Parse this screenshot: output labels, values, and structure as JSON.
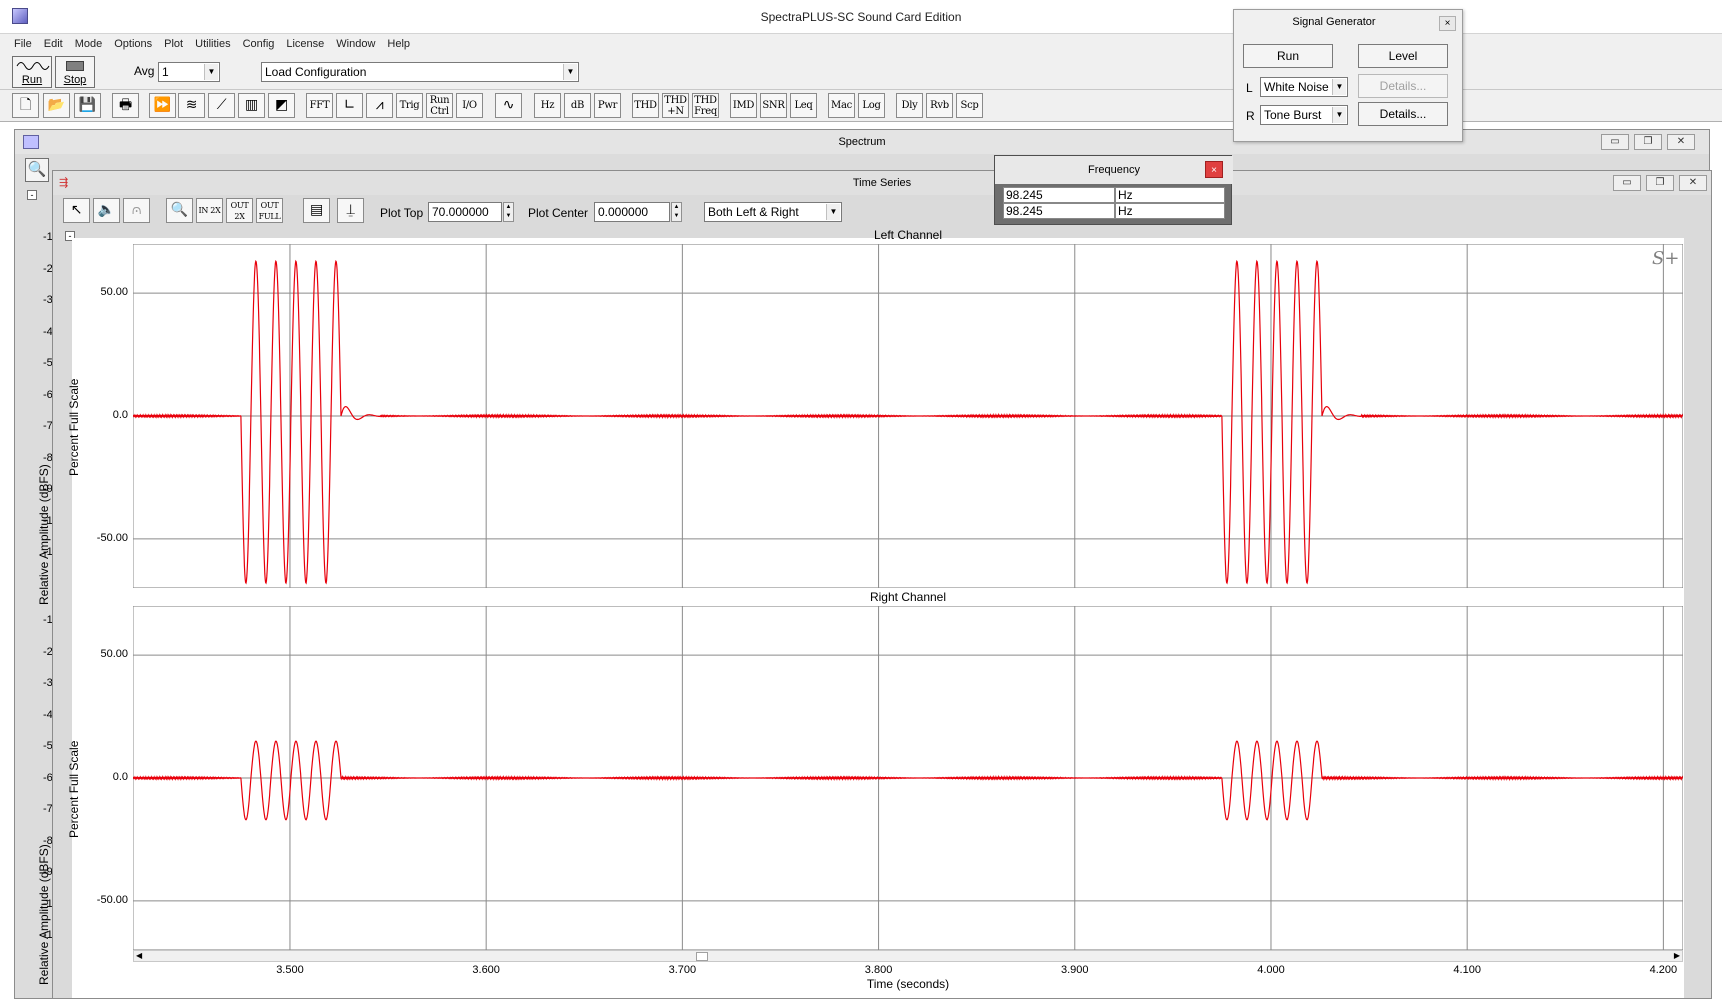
{
  "app": {
    "title": "SpectraPLUS-SC Sound Card Edition",
    "menu": [
      "File",
      "Edit",
      "Mode",
      "Options",
      "Plot",
      "Utilities",
      "Config",
      "License",
      "Window",
      "Help"
    ]
  },
  "toolbar": {
    "run_label": "Run",
    "stop_label": "Stop",
    "avg_label": "Avg",
    "avg_value": "1",
    "config_value": "Load Configuration",
    "buttons": [
      "FFT",
      "Trig",
      "Run Ctrl",
      "I/O",
      "Hz",
      "dB",
      "Pwr",
      "THD",
      "THD +N",
      "THD Freq",
      "IMD",
      "SNR",
      "Leq",
      "Mac",
      "Log",
      "Dly",
      "Rvb",
      "Scp"
    ]
  },
  "signal_generator": {
    "title": "Signal Generator",
    "close": "×",
    "run_label": "Run",
    "level_label": "Level",
    "left_label": "L",
    "right_label": "R",
    "left_value": "White Noise",
    "right_value": "Tone Burst",
    "details_left": "Details...",
    "details_right": "Details..."
  },
  "spectrum_window": {
    "title": "Spectrum",
    "ylabel": "Relative Amplitude (dBFS)",
    "ticks_top": [
      "-1",
      "-2",
      "-3",
      "-4",
      "-5",
      "-6",
      "-7",
      "-8",
      "-9",
      "-1",
      "-1"
    ],
    "ticks_bottom": [
      "-1",
      "-2",
      "-3",
      "-4",
      "-5",
      "-6",
      "-7",
      "-8",
      "-9",
      "-1",
      "-1"
    ]
  },
  "frequency_window": {
    "title": "Frequency",
    "close": "×",
    "rows": [
      {
        "value": "98.245",
        "unit": "Hz"
      },
      {
        "value": "98.245",
        "unit": "Hz"
      }
    ]
  },
  "time_series": {
    "title": "Time Series",
    "plot_top_label": "Plot Top",
    "plot_top_value": "70.000000",
    "plot_center_label": "Plot Center",
    "plot_center_value": "0.000000",
    "channel_mode": "Both Left & Right",
    "logo": "S+"
  },
  "chart_data": [
    {
      "type": "line",
      "title": "Left Channel",
      "xlabel": "Time (seconds)",
      "ylabel": "Percent Full Scale",
      "xlim": [
        3.42,
        4.21
      ],
      "ylim": [
        -70,
        70
      ],
      "yticks": [
        50,
        0,
        -50
      ],
      "ytick_labels": [
        "50.00",
        "0.0",
        "-50.00"
      ],
      "grid": true,
      "series": [
        {
          "color": "#e8000b",
          "bursts": [
            3.475,
            3.975
          ],
          "peak": 63,
          "trough": -68,
          "cycles": 5,
          "period": 0.0102
        }
      ]
    },
    {
      "type": "line",
      "title": "Right Channel",
      "xlabel": "Time (seconds)",
      "ylabel": "Percent Full Scale",
      "xlim": [
        3.42,
        4.21
      ],
      "ylim": [
        -70,
        70
      ],
      "yticks": [
        50,
        0,
        -50
      ],
      "ytick_labels": [
        "50.00",
        "0.0",
        "-50.00"
      ],
      "xticks": [
        3.5,
        3.6,
        3.7,
        3.8,
        3.9,
        4.0,
        4.1,
        4.2
      ],
      "xtick_labels": [
        "3.500",
        "3.600",
        "3.700",
        "3.800",
        "3.900",
        "4.000",
        "4.100",
        "4.200"
      ],
      "grid": true,
      "series": [
        {
          "color": "#e8000b",
          "bursts": [
            3.475,
            3.975
          ],
          "peak": 15,
          "trough": -17,
          "cycles": 5,
          "period": 0.0102
        }
      ]
    }
  ],
  "colors": {
    "trace": "#e8000b",
    "grid": "#7a7a7a",
    "window_bg": "#dcdcdc"
  }
}
